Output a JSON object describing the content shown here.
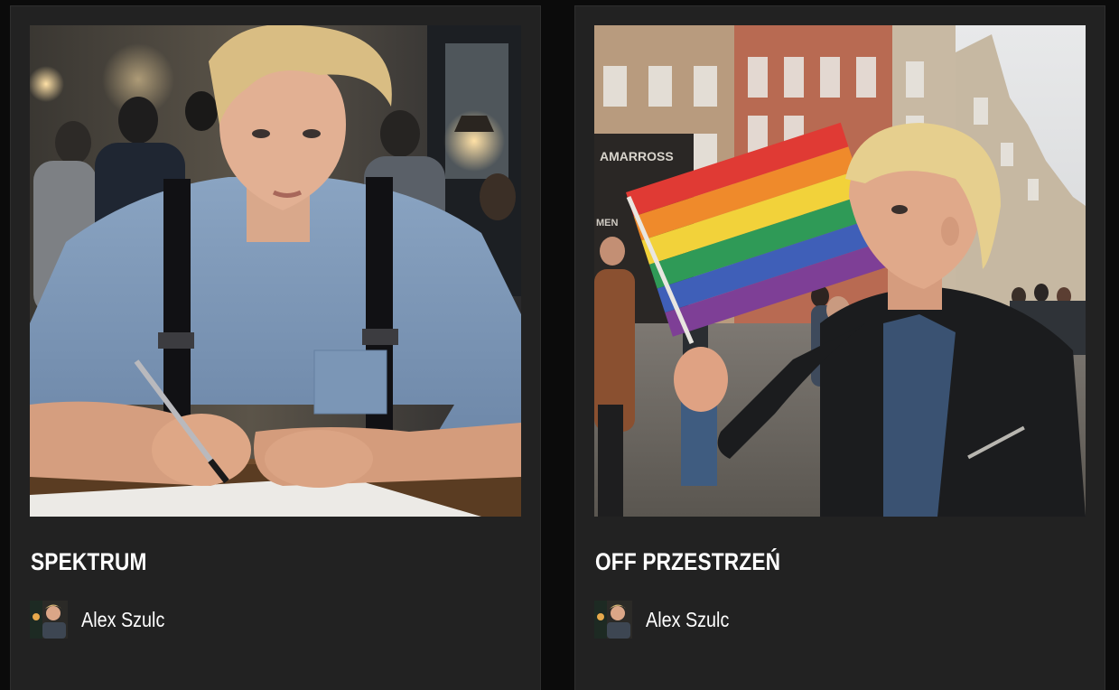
{
  "cards": [
    {
      "title": "SPEKTRUM",
      "author": "Alex Szulc",
      "cover_icon": "portrait-writing-image"
    },
    {
      "title": "OFF PRZESTRZEŃ",
      "author": "Alex Szulc",
      "cover_icon": "portrait-rainbow-flag-image",
      "shop_sign": "AMARROSS",
      "shop_sign_small": "MEN"
    }
  ],
  "colors": {
    "page_background": "#0b0b0b",
    "card_background": "#222222",
    "text": "#ffffff"
  }
}
